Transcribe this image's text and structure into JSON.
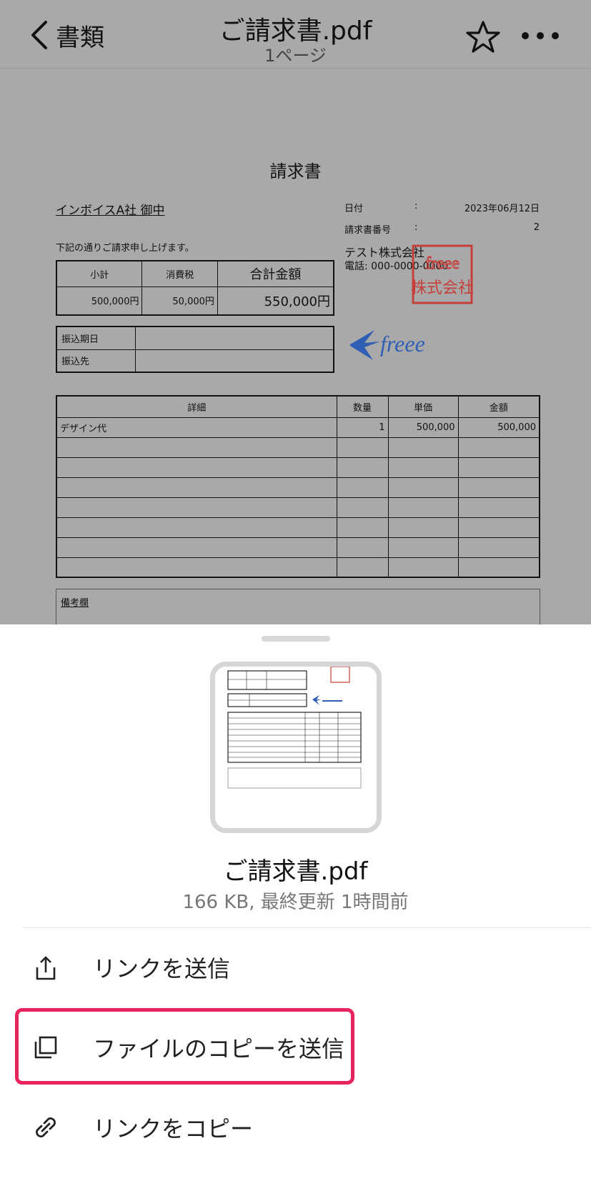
{
  "nav": {
    "back_label": "書類",
    "title": "ご請求書.pdf",
    "subtitle": "1ページ"
  },
  "invoice": {
    "title": "請求書",
    "client": "インボイスA社 御中",
    "note": "下記の通りご請求申し上げます。",
    "meta": [
      {
        "label": "日付",
        "colon": ":",
        "value": "2023年06月12日"
      },
      {
        "label": "請求書番号",
        "colon": ":",
        "value": "2"
      }
    ],
    "company": "テスト株式会社",
    "phone": "電話: 000-0000-0000",
    "seal_text": "freee株式会社",
    "logo_text": "freee",
    "summary": {
      "headers": [
        "小計",
        "消費税",
        "合計金額"
      ],
      "values": [
        "500,000円",
        "50,000円",
        "550,000円"
      ]
    },
    "bank": {
      "rows": [
        "振込期日",
        "振込先"
      ]
    },
    "details": {
      "headers": [
        "詳細",
        "数量",
        "単価",
        "金額"
      ],
      "rows": [
        [
          "デザイン代",
          "1",
          "500,000",
          "500,000"
        ],
        [
          "",
          "",
          "",
          ""
        ],
        [
          "",
          "",
          "",
          ""
        ],
        [
          "",
          "",
          "",
          ""
        ],
        [
          "",
          "",
          "",
          ""
        ],
        [
          "",
          "",
          "",
          ""
        ],
        [
          "",
          "",
          "",
          ""
        ],
        [
          "",
          "",
          "",
          ""
        ]
      ]
    },
    "remarks_label": "備考欄"
  },
  "sheet": {
    "file_name": "ご請求書.pdf",
    "file_meta": "166 KB, 最終更新 1時間前",
    "actions": [
      {
        "label": "リンクを送信",
        "icon": "share-icon"
      },
      {
        "label": "ファイルのコピーを送信",
        "icon": "copy-icon"
      },
      {
        "label": "リンクをコピー",
        "icon": "link-icon"
      }
    ],
    "highlight_color": "#e8245e"
  }
}
